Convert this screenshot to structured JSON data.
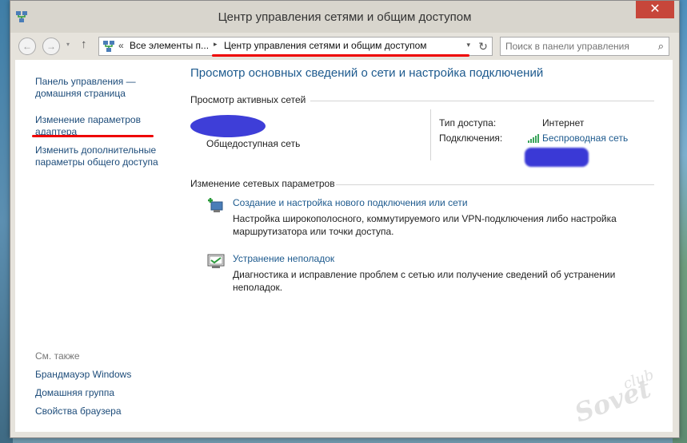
{
  "window": {
    "title": "Центр управления сетями и общим доступом",
    "close_glyph": "✕"
  },
  "navbar": {
    "back_glyph": "←",
    "forward_glyph": "→",
    "recent_glyph": "▾",
    "up_glyph": "↑",
    "address": {
      "overflow": "«",
      "crumb_1": "Все элементы п...",
      "separator": "▸",
      "current": "Центр управления сетями и общим доступом",
      "dropdown_glyph": "▾"
    },
    "refresh_glyph": "↻",
    "search_placeholder": "Поиск в панели управления",
    "search_glyph": "⌕"
  },
  "sidebar": {
    "home_link": "Панель управления — домашняя страница",
    "change_adapter": "Изменение параметров адаптера",
    "change_sharing": "Изменить дополнительные параметры общего доступа",
    "see_also": "См. также",
    "see_also_items": [
      "Брандмауэр Windows",
      "Домашняя группа",
      "Свойства браузера"
    ]
  },
  "main": {
    "title": "Просмотр основных сведений о сети и настройка подключений",
    "active_networks_heading": "Просмотр активных сетей",
    "network_type": "Общедоступная сеть",
    "access_type_label": "Тип доступа:",
    "access_type_value": "Интернет",
    "connections_label": "Подключения:",
    "connections_value": "Беспроводная сеть",
    "change_settings_heading": "Изменение сетевых параметров",
    "tasks": [
      {
        "title": "Создание и настройка нового подключения или сети",
        "description": "Настройка широкополосного, коммутируемого или VPN-подключения либо настройка маршрутизатора или точки доступа."
      },
      {
        "title": "Устранение неполадок",
        "description": "Диагностика и исправление проблем с сетью или получение сведений об устранении неполадок."
      }
    ]
  },
  "watermark": {
    "top": "club",
    "main": "Sovet"
  },
  "colors": {
    "link": "#1d5a8e",
    "annotation_red": "#e00000",
    "redaction_blue": "#3e3ed8",
    "close_button": "#c7463a"
  }
}
